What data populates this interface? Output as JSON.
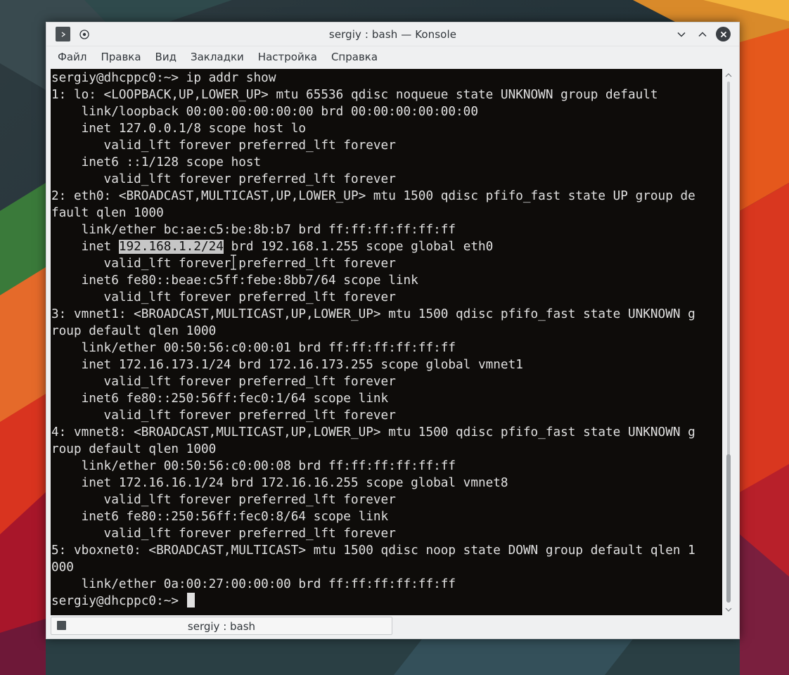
{
  "window": {
    "title": "sergiy : bash — Konsole"
  },
  "menu": [
    "Файл",
    "Правка",
    "Вид",
    "Закладки",
    "Настройка",
    "Справка"
  ],
  "terminal": {
    "lines": [
      "sergiy@dhcppc0:~> ip addr show",
      "1: lo: <LOOPBACK,UP,LOWER_UP> mtu 65536 qdisc noqueue state UNKNOWN group default",
      "    link/loopback 00:00:00:00:00:00 brd 00:00:00:00:00:00",
      "    inet 127.0.0.1/8 scope host lo",
      "       valid_lft forever preferred_lft forever",
      "    inet6 ::1/128 scope host",
      "       valid_lft forever preferred_lft forever",
      "2: eth0: <BROADCAST,MULTICAST,UP,LOWER_UP> mtu 1500 qdisc pfifo_fast state UP group de",
      "fault qlen 1000",
      "    link/ether bc:ae:c5:be:8b:b7 brd ff:ff:ff:ff:ff:ff",
      "    inet 192.168.1.2/24 brd 192.168.1.255 scope global eth0",
      "       valid_lft forever preferred_lft forever",
      "    inet6 fe80::beae:c5ff:febe:8bb7/64 scope link",
      "       valid_lft forever preferred_lft forever",
      "3: vmnet1: <BROADCAST,MULTICAST,UP,LOWER_UP> mtu 1500 qdisc pfifo_fast state UNKNOWN g",
      "roup default qlen 1000",
      "    link/ether 00:50:56:c0:00:01 brd ff:ff:ff:ff:ff:ff",
      "    inet 172.16.173.1/24 brd 172.16.173.255 scope global vmnet1",
      "       valid_lft forever preferred_lft forever",
      "    inet6 fe80::250:56ff:fec0:1/64 scope link",
      "       valid_lft forever preferred_lft forever",
      "4: vmnet8: <BROADCAST,MULTICAST,UP,LOWER_UP> mtu 1500 qdisc pfifo_fast state UNKNOWN g",
      "roup default qlen 1000",
      "    link/ether 00:50:56:c0:00:08 brd ff:ff:ff:ff:ff:ff",
      "    inet 172.16.16.1/24 brd 172.16.16.255 scope global vmnet8",
      "       valid_lft forever preferred_lft forever",
      "    inet6 fe80::250:56ff:fec0:8/64 scope link",
      "       valid_lft forever preferred_lft forever",
      "5: vboxnet0: <BROADCAST,MULTICAST> mtu 1500 qdisc noop state DOWN group default qlen 1",
      "000",
      "    link/ether 0a:00:27:00:00:00 brd ff:ff:ff:ff:ff:ff",
      "sergiy@dhcppc0:~> "
    ],
    "selection": {
      "line_index": 10,
      "text": "192.168.1.2/24"
    },
    "cursor_line_index": 31
  },
  "tabs": [
    {
      "label": "sergiy : bash",
      "icon": "terminal-icon",
      "active": true
    }
  ],
  "icons": {
    "app": "konsole-icon",
    "pin": "pin-icon",
    "minimize": "minimize-icon",
    "maximize": "maximize-icon",
    "close": "close-icon",
    "scroll_up": "scroll-up-icon",
    "scroll_down": "scroll-down-icon",
    "text_cursor": "ibeam-cursor-icon"
  },
  "colors": {
    "terminal_bg": "#0e0c0a",
    "terminal_fg": "#e0e0e0",
    "selection_bg": "#c6c6c6",
    "chrome_bg": "#eff0f1",
    "chrome_text": "#31363b"
  }
}
